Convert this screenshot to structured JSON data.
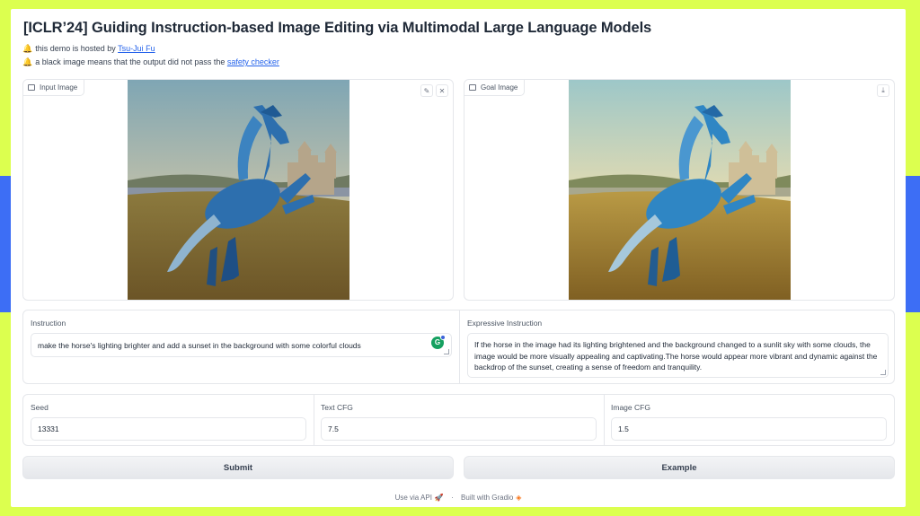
{
  "header": {
    "title": "[ICLR’24] Guiding Instruction-based Image Editing via Multimodal Large Language Models",
    "note1_prefix": "this demo is hosted by",
    "note1_link": "Tsu-Jui Fu",
    "note2_prefix": "a black image means that the output did not pass the",
    "note2_link": "safety checker"
  },
  "input_image": {
    "label": "Input Image",
    "edit_icon": "pencil-icon",
    "clear_icon": "close-icon"
  },
  "goal_image": {
    "label": "Goal Image",
    "download_icon": "download-icon"
  },
  "instruction": {
    "label": "Instruction",
    "value": "make the horse's lighting brighter and add a sunset in the background with some colorful clouds",
    "badge_text": "G",
    "badge_count": "1"
  },
  "expressive_instruction": {
    "label": "Expressive Instruction",
    "value": "If the horse in the image had its lighting brightened and the background changed to a sunlit sky with some clouds, the image would be more visually appealing and captivating.The horse would appear more vibrant and dynamic against the backdrop of the sunset, creating a sense of freedom and tranquility."
  },
  "params": {
    "seed_label": "Seed",
    "seed_value": "13331",
    "text_cfg_label": "Text CFG",
    "text_cfg_value": "7.5",
    "image_cfg_label": "Image CFG",
    "image_cfg_value": "1.5"
  },
  "buttons": {
    "submit": "Submit",
    "example": "Example"
  },
  "footer": {
    "api": "Use via API",
    "sep": "·",
    "built": "Built with Gradio"
  },
  "colors": {
    "background": "#dcff4f",
    "side_band": "#3d6ef5",
    "link": "#2563eb"
  }
}
